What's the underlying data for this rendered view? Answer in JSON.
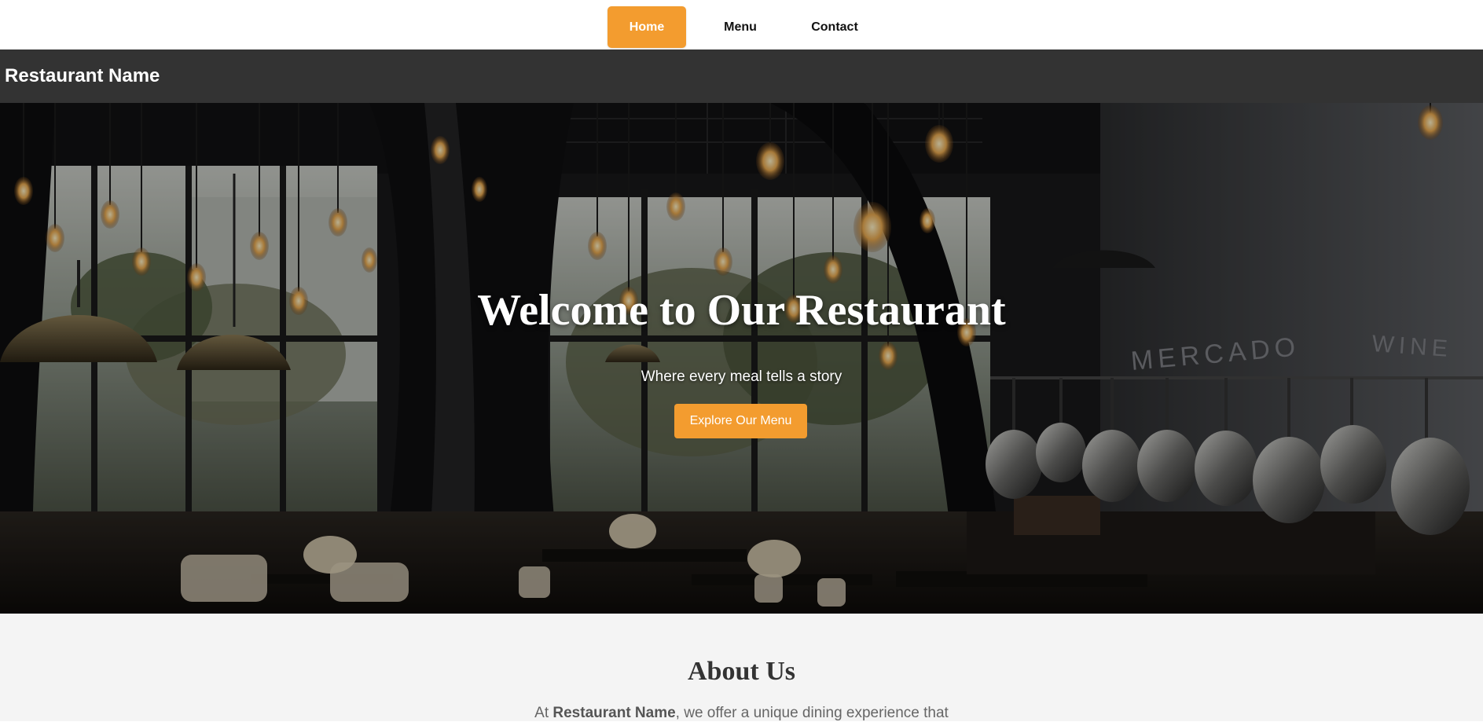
{
  "nav": {
    "items": [
      {
        "label": "Home",
        "active": true
      },
      {
        "label": "Menu",
        "active": false
      },
      {
        "label": "Contact",
        "active": false
      }
    ]
  },
  "header": {
    "brand": "Restaurant Name"
  },
  "hero": {
    "title": "Welcome to Our Restaurant",
    "subtitle": "Where every meal tells a story",
    "cta_label": "Explore Our Menu",
    "signage": {
      "left": "MERCADO",
      "right": "WINE"
    }
  },
  "about": {
    "title": "About Us",
    "text_prefix": "At ",
    "text_brand": "Restaurant Name",
    "text_suffix": ", we offer a unique dining experience that"
  },
  "colors": {
    "accent": "#f39c2f",
    "header_bg": "#333333",
    "about_bg": "#f4f4f4"
  }
}
